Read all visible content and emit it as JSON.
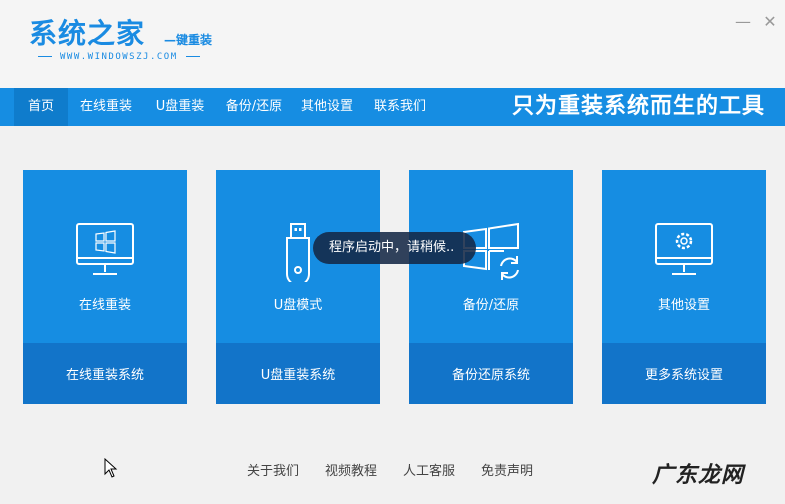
{
  "header": {
    "title": "系统之家",
    "subtitle": "—键重装",
    "url": "WWW.WINDOWSZJ.COM",
    "minimize": "—",
    "close": "✕"
  },
  "nav": {
    "items": [
      {
        "label": "首页"
      },
      {
        "label": "在线重装"
      },
      {
        "label": "U盘重装"
      },
      {
        "label": "备份/还原"
      },
      {
        "label": "其他设置"
      },
      {
        "label": "联系我们"
      }
    ],
    "slogan": "只为重装系统而生的工具"
  },
  "cards": [
    {
      "title": "在线重装",
      "footer": "在线重装系统",
      "icon": "monitor-windows-icon"
    },
    {
      "title": "U盘模式",
      "footer": "U盘重装系统",
      "icon": "usb-drive-icon"
    },
    {
      "title": "备份/还原",
      "footer": "备份还原系统",
      "icon": "windows-restore-icon"
    },
    {
      "title": "其他设置",
      "footer": "更多系统设置",
      "icon": "monitor-gear-icon"
    }
  ],
  "toast": {
    "text": "程序启动中，请稍候.."
  },
  "footer": {
    "links": [
      {
        "label": "关于我们"
      },
      {
        "label": "视频教程"
      },
      {
        "label": "人工客服"
      },
      {
        "label": "免责声明"
      }
    ]
  },
  "watermark": "广东龙网",
  "colors": {
    "accent": "#168de2",
    "accent_dark": "#1274c9",
    "background": "#f1f1f1"
  }
}
